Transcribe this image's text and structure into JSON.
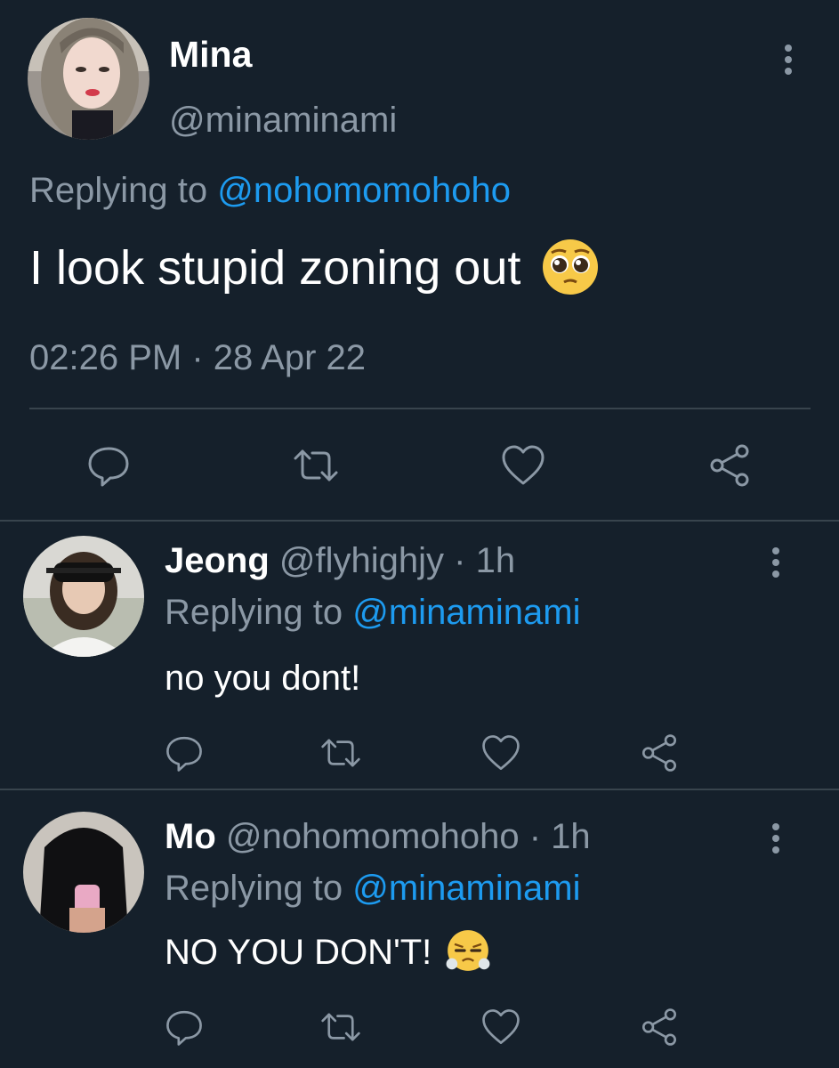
{
  "main_tweet": {
    "name": "Mina",
    "handle": "@minaminami",
    "replying_prefix": "Replying to",
    "replying_to": "@nohomomohoho",
    "text": "I look stupid zoning out",
    "text_emoji": "pleading-face",
    "timestamp": "02:26 PM · 28 Apr 22"
  },
  "replies": [
    {
      "name": "Jeong",
      "handle": "@flyhighjy",
      "time": "· 1h",
      "replying_prefix": "Replying to",
      "replying_to": "@minaminami",
      "text": "no you dont!"
    },
    {
      "name": "Mo",
      "handle": "@nohomomohoho",
      "time": "· 1h",
      "replying_prefix": "Replying to",
      "replying_to": "@minaminami",
      "text": "NO YOU DON'T!",
      "text_emoji": "face-with-steam-from-nose"
    }
  ],
  "icons": [
    "reply-icon",
    "retweet-icon",
    "like-icon",
    "share-icon",
    "more-options-icon"
  ],
  "colors": {
    "background": "#15202b",
    "text": "#ffffff",
    "muted": "#8b98a5",
    "link": "#1d9bf0",
    "divider": "#38444d"
  }
}
